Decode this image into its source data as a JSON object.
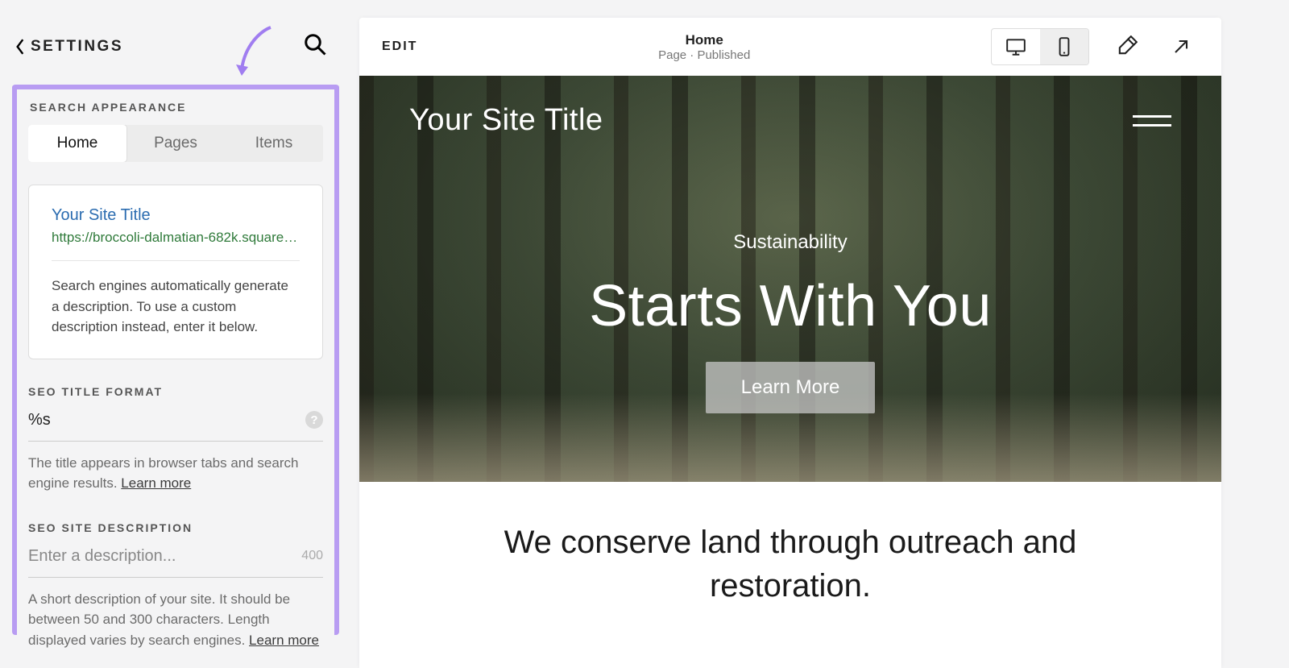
{
  "sidebar": {
    "back_label": "SETTINGS",
    "section_label": "SEARCH APPEARANCE",
    "tabs": [
      "Home",
      "Pages",
      "Items"
    ],
    "preview": {
      "title": "Your Site Title",
      "url": "https://broccoli-dalmatian-682k.squares...",
      "desc": "Search engines automatically generate a description. To use a custom description instead, enter it below."
    },
    "title_format": {
      "label": "SEO TITLE FORMAT",
      "value": "%s",
      "help": "The title appears in browser tabs and search engine results. ",
      "learn_more": "Learn more"
    },
    "site_desc": {
      "label": "SEO SITE DESCRIPTION",
      "placeholder": "Enter a description...",
      "char_count": "400",
      "help": "A short description of your site. It should be between 50 and 300 characters. Length displayed varies by search engines. ",
      "learn_more": "Learn more"
    }
  },
  "topbar": {
    "edit": "EDIT",
    "page_title": "Home",
    "page_sub": "Page · Published"
  },
  "hero": {
    "site_title": "Your Site Title",
    "eyebrow": "Sustainability",
    "heading": "Starts With You",
    "cta": "Learn More"
  },
  "tagline": "We conserve land through outreach and restoration."
}
